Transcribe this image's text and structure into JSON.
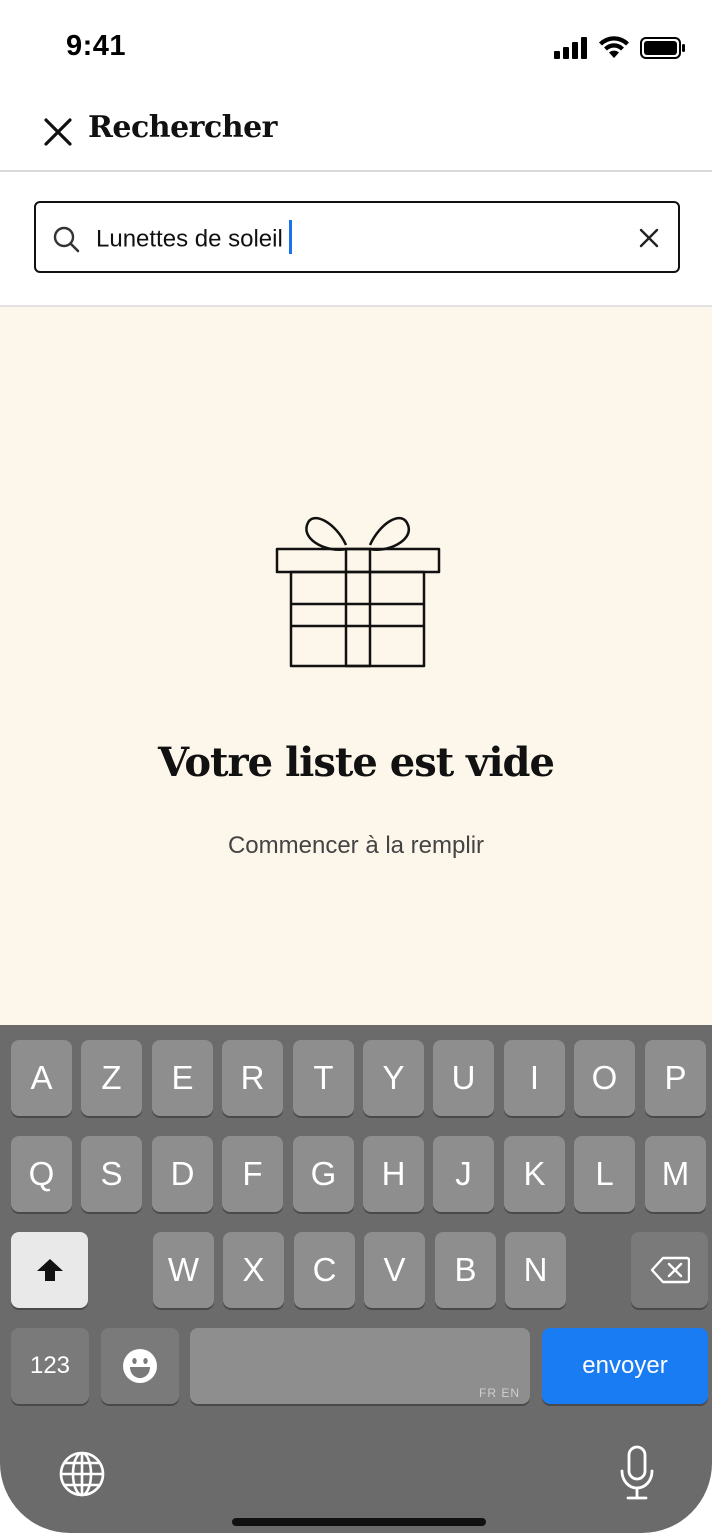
{
  "status_bar": {
    "time": "9:41"
  },
  "header": {
    "title": "Rechercher"
  },
  "search": {
    "value": "Lunettes de soleil"
  },
  "empty_state": {
    "title": "Votre liste est vide",
    "subtitle": "Commencer à la remplir"
  },
  "keyboard": {
    "row1": [
      "A",
      "Z",
      "E",
      "R",
      "T",
      "Y",
      "U",
      "I",
      "O",
      "P"
    ],
    "row2": [
      "Q",
      "S",
      "D",
      "F",
      "G",
      "H",
      "J",
      "K",
      "L",
      "M"
    ],
    "row3": [
      "W",
      "X",
      "C",
      "V",
      "B",
      "N"
    ],
    "numbers_label": "123",
    "space_lang": "FR EN",
    "send_label": "envoyer"
  },
  "colors": {
    "accent": "#1a7cf2",
    "empty_bg": "#fdf6ea",
    "keyboard_bg": "#6b6b6b"
  }
}
